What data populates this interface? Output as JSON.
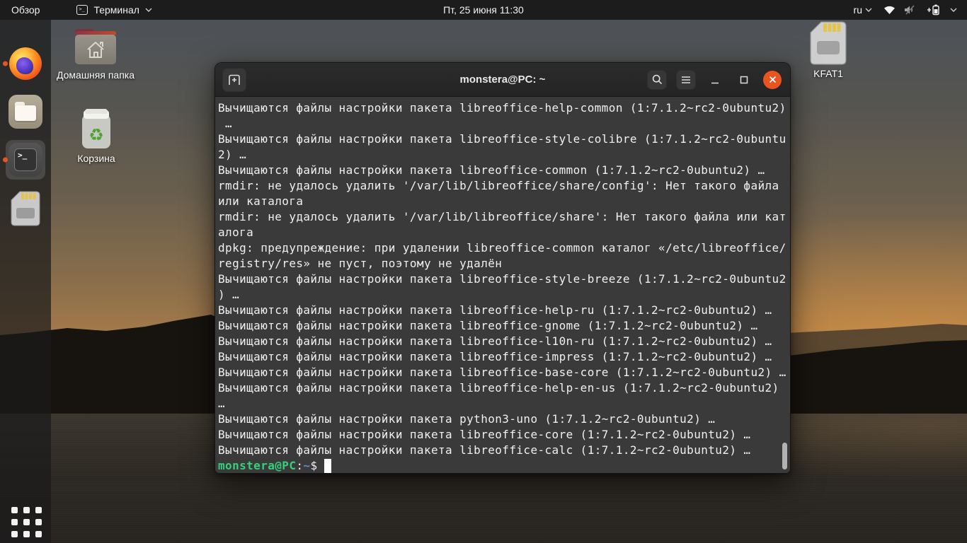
{
  "topbar": {
    "activities": "Обзор",
    "app_name": "Терминал",
    "app_icon_glyph": ">_",
    "clock": "Пт, 25 июня  11:30",
    "keyboard_layout": "ru"
  },
  "dock": {
    "terminal_glyph": ">_"
  },
  "desktop_icons": {
    "home_label": "Домашняя папка",
    "trash_label": "Корзина",
    "trash_glyph": "♻",
    "drive_label": "KFAT1"
  },
  "terminal": {
    "title": "monstera@PC: ~",
    "lines": [
      "Вычищаются файлы настройки пакета libreoffice-help-common (1:7.1.2~rc2-0ubuntu2)",
      " …",
      "Вычищаются файлы настройки пакета libreoffice-style-colibre (1:7.1.2~rc2-0ubuntu",
      "2) …",
      "Вычищаются файлы настройки пакета libreoffice-common (1:7.1.2~rc2-0ubuntu2) …",
      "rmdir: не удалось удалить '/var/lib/libreoffice/share/config': Нет такого файла",
      "или каталога",
      "rmdir: не удалось удалить '/var/lib/libreoffice/share': Нет такого файла или кат",
      "алога",
      "dpkg: предупреждение: при удалении libreoffice-common каталог «/etc/libreoffice/",
      "registry/res» не пуст, поэтому не удалён",
      "Вычищаются файлы настройки пакета libreoffice-style-breeze (1:7.1.2~rc2-0ubuntu2",
      ") …",
      "Вычищаются файлы настройки пакета libreoffice-help-ru (1:7.1.2~rc2-0ubuntu2) …",
      "Вычищаются файлы настройки пакета libreoffice-gnome (1:7.1.2~rc2-0ubuntu2) …",
      "Вычищаются файлы настройки пакета libreoffice-l10n-ru (1:7.1.2~rc2-0ubuntu2) …",
      "Вычищаются файлы настройки пакета libreoffice-impress (1:7.1.2~rc2-0ubuntu2) …",
      "Вычищаются файлы настройки пакета libreoffice-base-core (1:7.1.2~rc2-0ubuntu2) …",
      "Вычищаются файлы настройки пакета libreoffice-help-en-us (1:7.1.2~rc2-0ubuntu2)",
      "…",
      "Вычищаются файлы настройки пакета python3-uno (1:7.1.2~rc2-0ubuntu2) …",
      "Вычищаются файлы настройки пакета libreoffice-core (1:7.1.2~rc2-0ubuntu2) …",
      "Вычищаются файлы настройки пакета libreoffice-calc (1:7.1.2~rc2-0ubuntu2) …"
    ],
    "prompt": {
      "user_host": "monstera@PC",
      "sep": ":",
      "path": "~",
      "symbol": "$"
    }
  },
  "colors": {
    "accent_orange": "#E95420",
    "prompt_green": "#33D17A",
    "path_blue": "#5C8AD2",
    "terminal_bg": "#3A3A3A",
    "topbar_bg": "#1C1C1C"
  }
}
